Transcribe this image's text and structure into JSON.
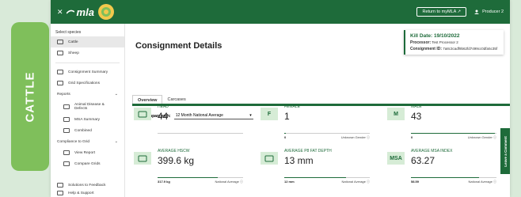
{
  "side_tab": "CATTLE",
  "topbar": {
    "close": "✕",
    "logo": "mla",
    "return_label": "Return to myMLA ↗",
    "producer": "Producer 2"
  },
  "sidebar": {
    "species_heading": "Select species",
    "species": [
      {
        "label": "Cattle",
        "active": true
      },
      {
        "label": "Sheep",
        "active": false
      }
    ],
    "items": [
      {
        "label": "Consignment Summary"
      },
      {
        "label": "Grid Specifications"
      }
    ],
    "reports": {
      "label": "Reports",
      "children": [
        "Animal Disease & Defects",
        "MSA Summary",
        "Combined"
      ]
    },
    "compliance": {
      "label": "Compliance to Grid",
      "children": [
        "View Report",
        "Compare Grids"
      ]
    },
    "bottom": [
      "Solutions to Feedback",
      "Help & Support"
    ]
  },
  "main": {
    "title": "Consignment Details",
    "kill_card": {
      "kill_date": "Kill Date: 19/10/2022",
      "processor_label": "Processor:",
      "processor": "Test Processor 2",
      "consignment_label": "Consignment ID:",
      "consignment_id": "7a8c3cadf9b62fd7499cc0dfa5c35f"
    },
    "tabs": [
      "Overview",
      "Carcases"
    ],
    "compare_label": "Compare with:",
    "compare_value": "12 Month National Average",
    "feedback_label": "Leave a Comment"
  },
  "metrics": [
    {
      "badge_icon": "cow-head-icon",
      "badge_text": "",
      "label": "HEAD",
      "value": "44",
      "foot_left": "",
      "foot_right": "",
      "bar": 0
    },
    {
      "badge_icon": "",
      "badge_text": "F",
      "label": "FEMALE",
      "value": "1",
      "foot_left": "0",
      "foot_right": "Unknown Gender ⓘ",
      "bar": 0.02
    },
    {
      "badge_icon": "",
      "badge_text": "M",
      "label": "MALE",
      "value": "43",
      "foot_left": "0",
      "foot_right": "Unknown Gender ⓘ",
      "bar": 0.98
    },
    {
      "badge_icon": "scale-icon",
      "badge_text": "",
      "label": "AVERAGE HSCW",
      "value": "399.6 kg",
      "foot_left": "317.9 kg",
      "foot_right": "National Average ⓘ",
      "bar": 0.7
    },
    {
      "badge_icon": "ruler-icon",
      "badge_text": "",
      "label": "AVERAGE P8 FAT DEPTH",
      "value": "13 mm",
      "foot_left": "12 mm",
      "foot_right": "National Average ⓘ",
      "bar": 0.72
    },
    {
      "badge_icon": "",
      "badge_text": "MSA",
      "label": "AVERAGE MSA INDEX",
      "value": "63.27",
      "foot_left": "58.59",
      "foot_right": "National Average ⓘ",
      "bar": 0.8
    }
  ],
  "colors": {
    "brand": "#1e6b3a",
    "side_tab": "#7fbf5b",
    "badge_bg": "#d6ecd6"
  }
}
